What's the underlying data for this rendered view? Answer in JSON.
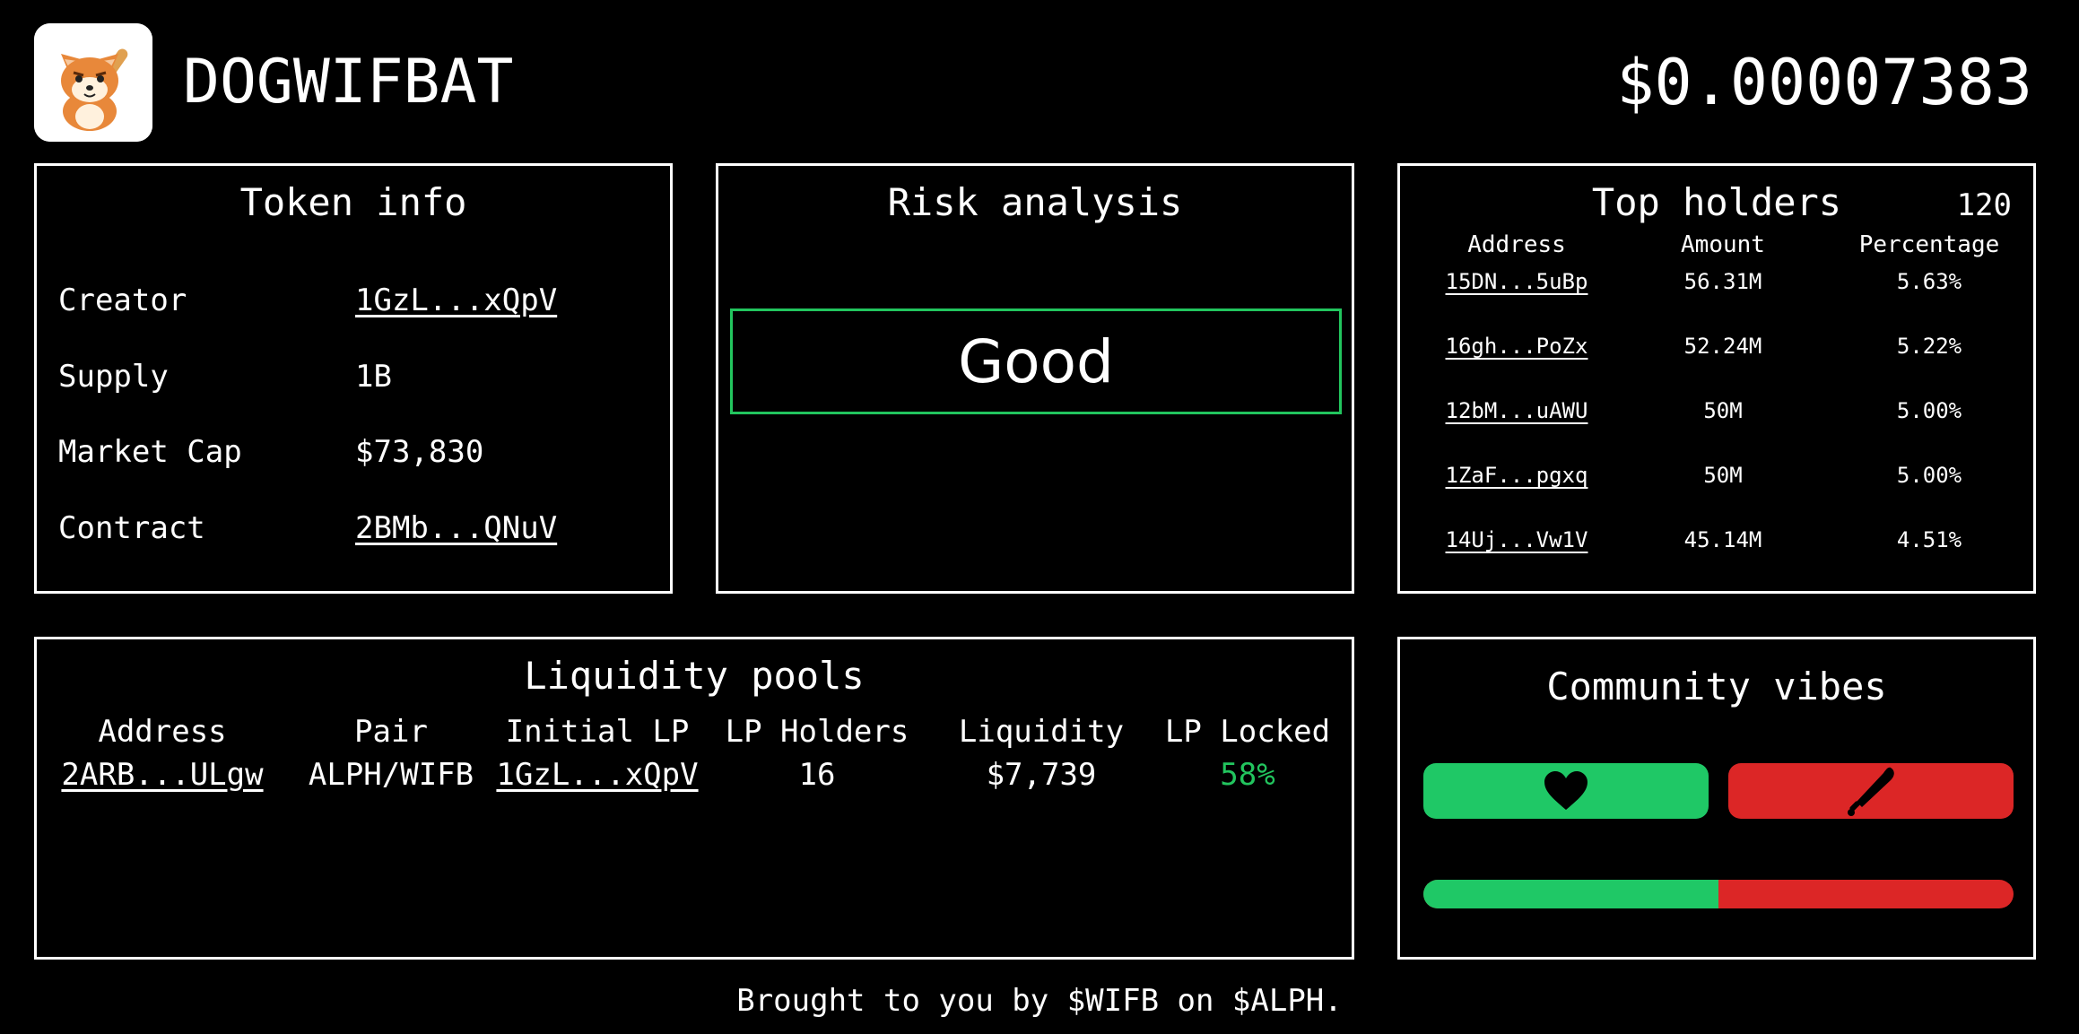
{
  "header": {
    "title": "DOGWIFBAT",
    "price": "$0.00007383",
    "logo_icon": "dog-with-bat-logo"
  },
  "token_info": {
    "title": "Token info",
    "rows": [
      {
        "label": "Creator",
        "value": "1GzL...xQpV",
        "link": true
      },
      {
        "label": "Supply",
        "value": "1B",
        "link": false
      },
      {
        "label": "Market Cap",
        "value": "$73,830",
        "link": false
      },
      {
        "label": "Contract",
        "value": "2BMb...QNuV",
        "link": true
      }
    ]
  },
  "risk": {
    "title": "Risk analysis",
    "rating": "Good",
    "rating_color": "#22c55e"
  },
  "holders": {
    "title": "Top holders",
    "count": "120",
    "columns": [
      "Address",
      "Amount",
      "Percentage"
    ],
    "rows": [
      {
        "address": "15DN...5uBp",
        "amount": "56.31M",
        "percentage": "5.63%"
      },
      {
        "address": "16gh...PoZx",
        "amount": "52.24M",
        "percentage": "5.22%"
      },
      {
        "address": "12bM...uAWU",
        "amount": "50M",
        "percentage": "5.00%"
      },
      {
        "address": "1ZaF...pgxq",
        "amount": "50M",
        "percentage": "5.00%"
      },
      {
        "address": "14Uj...Vw1V",
        "amount": "45.14M",
        "percentage": "4.51%"
      }
    ]
  },
  "liquidity": {
    "title": "Liquidity pools",
    "columns": [
      "Address",
      "Pair",
      "Initial LP",
      "LP Holders",
      "Liquidity",
      "LP Locked"
    ],
    "rows": [
      {
        "address": "2ARB...ULgw",
        "pair": "ALPH/WIFB",
        "initial_lp": "1GzL...xQpV",
        "lp_holders": "16",
        "liquidity": "$7,739",
        "lp_locked": "58%"
      }
    ],
    "locked_color": "#22c55e"
  },
  "vibes": {
    "title": "Community vibes",
    "like_icon": "heart-icon",
    "dislike_icon": "baseball-bat-icon",
    "like_color": "#1fc866",
    "dislike_color": "#dc2626",
    "positive_fraction": 0.5
  },
  "footer": {
    "text": "Brought to you by $WIFB on $ALPH."
  }
}
